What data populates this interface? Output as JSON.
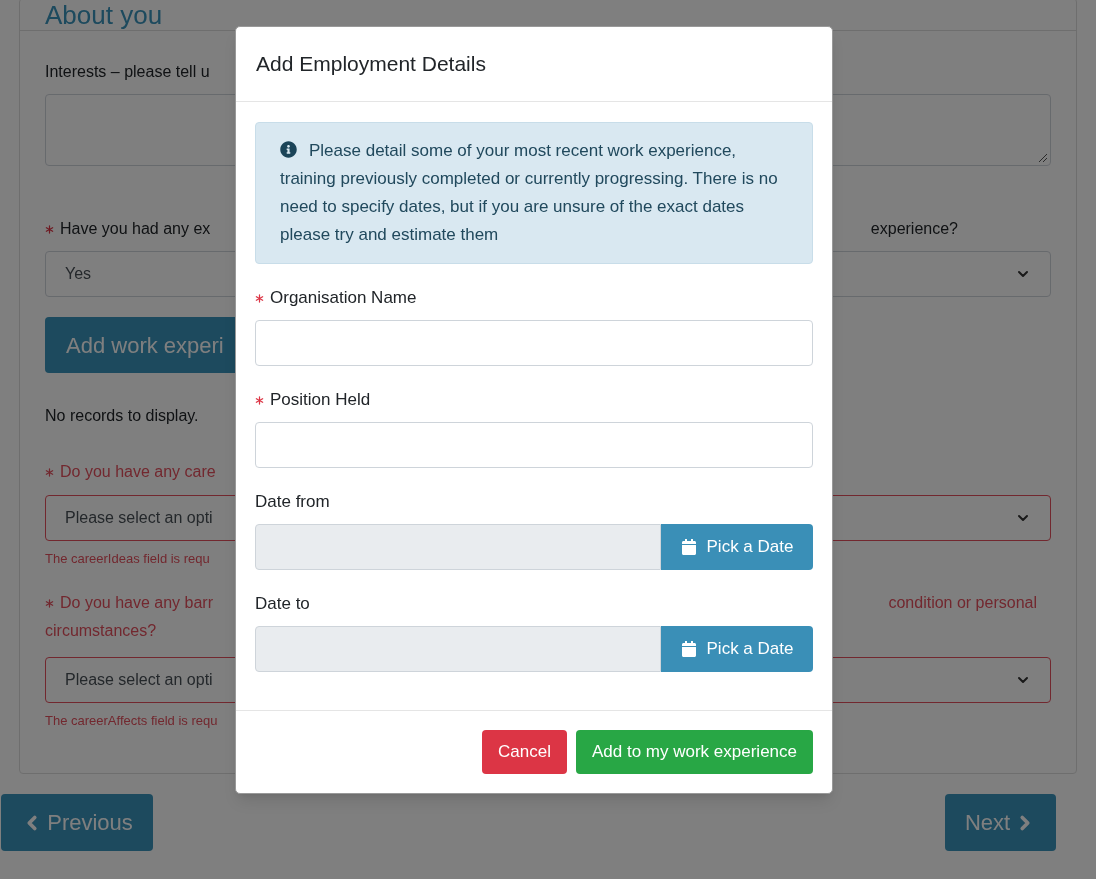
{
  "page": {
    "heading": "About you",
    "interests": {
      "label": "Interests – please tell u"
    },
    "experience_question": {
      "required": true,
      "invalid": false,
      "label_start": "Have you had any ex",
      "label_end": "experience?",
      "value": "Yes"
    },
    "add_button": "Add work experi",
    "no_records": "No records to display.",
    "career_ideas": {
      "required": true,
      "invalid": true,
      "label": "Do you have any care",
      "placeholder": "Please select an opti",
      "error": "The careerIdeas field is requ"
    },
    "career_affects": {
      "required": true,
      "invalid": true,
      "label_start": "Do you have any barr",
      "label_end": "condition or personal",
      "label_line2": "circumstances?",
      "placeholder": "Please select an opti",
      "error": "The careerAffects field is requ"
    }
  },
  "nav": {
    "previous": "Previous",
    "next": "Next"
  },
  "modal": {
    "title": "Add Employment Details",
    "info": "Please detail some of your most recent work experience, training previously completed or currently progressing. There is no need to specify dates, but if you are unsure of the exact dates please try and estimate them",
    "fields": [
      {
        "kind": "text",
        "label": "Organisation Name",
        "required": true
      },
      {
        "kind": "text",
        "label": "Position Held",
        "required": true
      },
      {
        "kind": "date",
        "label": "Date from",
        "required": false,
        "button": "Pick a Date"
      },
      {
        "kind": "date",
        "label": "Date to",
        "required": false,
        "button": "Pick a Date"
      }
    ],
    "cancel": "Cancel",
    "submit": "Add to my work experience"
  }
}
